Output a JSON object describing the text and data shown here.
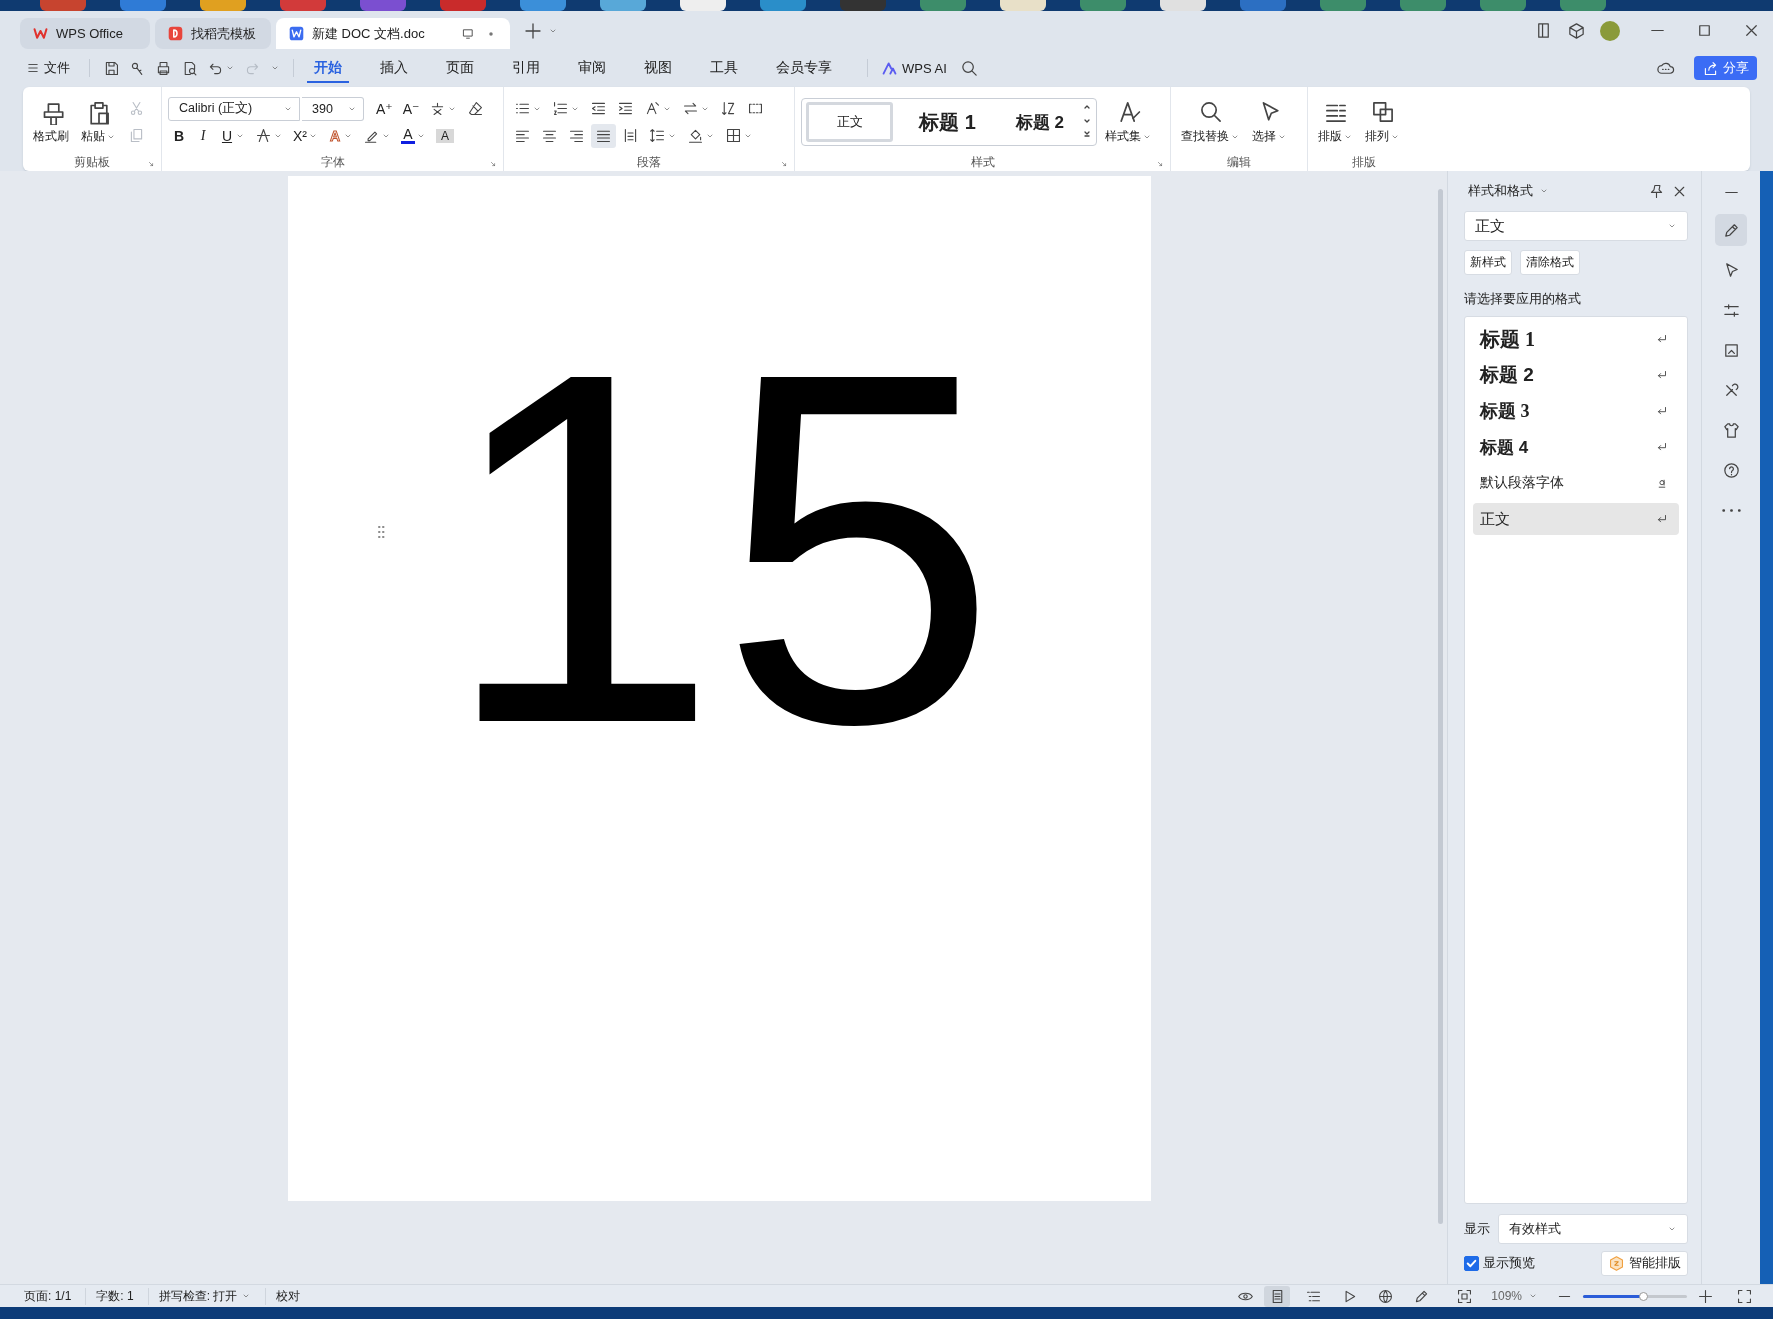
{
  "tabs": [
    {
      "label": "WPS Office",
      "kind": "home",
      "selected": false
    },
    {
      "label": "找稻壳模板",
      "kind": "template",
      "selected": false
    },
    {
      "label": "新建 DOC 文档.doc",
      "kind": "document",
      "selected": true
    }
  ],
  "menu": {
    "file": "文件",
    "tabs": [
      {
        "label": "开始",
        "selected": true
      },
      {
        "label": "插入",
        "selected": false
      },
      {
        "label": "页面",
        "selected": false
      },
      {
        "label": "引用",
        "selected": false
      },
      {
        "label": "审阅",
        "selected": false
      },
      {
        "label": "视图",
        "selected": false
      },
      {
        "label": "工具",
        "selected": false
      },
      {
        "label": "会员专享",
        "selected": false
      }
    ],
    "ai": "WPS AI",
    "share": "分享"
  },
  "ribbon": {
    "clipboard": {
      "title": "剪贴板",
      "buttons": [
        {
          "label": "格式刷",
          "kind": "painter"
        },
        {
          "label": "粘贴",
          "kind": "paste",
          "dropdown": true
        }
      ],
      "small": [
        {
          "kind": "cut",
          "disabled": true
        },
        {
          "kind": "copy",
          "disabled": true
        }
      ]
    },
    "font": {
      "title": "字体",
      "name": "Calibri (正文)",
      "size": "390",
      "top": [
        {
          "kind": "grow",
          "glyph": "A⁺"
        },
        {
          "kind": "shrink",
          "glyph": "A⁻"
        },
        {
          "kind": "phonetic",
          "dropdown": true
        },
        {
          "kind": "eraser"
        }
      ],
      "bottom": [
        {
          "kind": "bold",
          "glyph": "B"
        },
        {
          "kind": "italic",
          "glyph": "I"
        },
        {
          "kind": "underline",
          "glyph": "U",
          "dropdown": true
        },
        {
          "kind": "strike",
          "dropdown": true
        },
        {
          "kind": "superscript",
          "glyph": "X²",
          "dropdown": true
        },
        {
          "kind": "effect",
          "glyph": "A",
          "dropdown": true
        },
        {
          "kind": "highlight",
          "dropdown": true
        },
        {
          "kind": "color",
          "glyph": "A",
          "dropdown": true
        },
        {
          "kind": "shading",
          "glyph": "A"
        }
      ]
    },
    "paragraph": {
      "title": "段落",
      "top": [
        {
          "kind": "bullets",
          "dropdown": true
        },
        {
          "kind": "numbering",
          "dropdown": true
        },
        {
          "kind": "outdent"
        },
        {
          "kind": "indent"
        },
        {
          "kind": "direction",
          "dropdown": true
        },
        {
          "kind": "swap",
          "dropdown": true
        },
        {
          "kind": "sort"
        },
        {
          "kind": "marks"
        }
      ],
      "alignment": [
        {
          "kind": "align-left",
          "selected": false
        },
        {
          "kind": "align-center",
          "selected": false
        },
        {
          "kind": "align-right",
          "selected": false
        },
        {
          "kind": "justify",
          "selected": true
        },
        {
          "kind": "distribute",
          "selected": false
        }
      ],
      "bottom": [
        {
          "kind": "spacing",
          "dropdown": true
        },
        {
          "kind": "fill",
          "dropdown": true
        },
        {
          "kind": "border",
          "dropdown": true
        }
      ]
    },
    "styles": {
      "title": "样式",
      "gallery": [
        {
          "label": "正文",
          "kind": "normal",
          "selected": true
        },
        {
          "label": "标题 1",
          "kind": "heading1",
          "selected": false
        },
        {
          "label": "标题 2",
          "kind": "heading2",
          "selected": false
        }
      ],
      "style_set": {
        "label": "样式集",
        "kind": "style-set",
        "dropdown": true
      }
    },
    "editing": {
      "title": "编辑",
      "buttons": [
        {
          "label": "查找替换",
          "kind": "find",
          "dropdown": true
        },
        {
          "label": "选择",
          "kind": "select",
          "dropdown": true
        }
      ]
    },
    "arrange": {
      "title": "排版",
      "buttons": [
        {
          "label": "排版",
          "kind": "layout",
          "dropdown": true
        },
        {
          "label": "排列",
          "kind": "arrange",
          "dropdown": true
        }
      ]
    }
  },
  "document": {
    "text": "15"
  },
  "panel": {
    "title": "样式和格式",
    "current_style": "正文",
    "buttons": [
      "新样式",
      "清除格式"
    ],
    "prompt": "请选择要应用的格式",
    "styles": [
      {
        "label": "标题 1",
        "kind": "heading1",
        "selected": false
      },
      {
        "label": "标题 2",
        "kind": "heading2",
        "selected": false
      },
      {
        "label": "标题 3",
        "kind": "heading3",
        "selected": false
      },
      {
        "label": "标题 4",
        "kind": "heading4",
        "selected": false
      },
      {
        "label": "默认段落字体",
        "kind": "character",
        "selected": false
      },
      {
        "label": "正文",
        "kind": "paragraph",
        "selected": true
      }
    ],
    "show_label": "显示",
    "show_value": "有效样式",
    "preview": {
      "label": "显示预览",
      "checked": true
    },
    "smart_button": "智能排版"
  },
  "side_tools": [
    {
      "kind": "pen",
      "selected": true
    },
    {
      "kind": "cursor",
      "selected": false
    },
    {
      "kind": "sliders",
      "selected": false
    },
    {
      "kind": "image",
      "selected": false
    },
    {
      "kind": "tools",
      "selected": false
    },
    {
      "kind": "shirt",
      "selected": false
    },
    {
      "kind": "help",
      "selected": false
    },
    {
      "kind": "more",
      "selected": false
    }
  ],
  "status_bar": {
    "page": "页面: 1/1",
    "words": "字数: 1",
    "spell": "拼写检查: 打开",
    "proofread": "校对",
    "views": [
      {
        "kind": "page",
        "selected": true
      },
      {
        "kind": "outline",
        "selected": false
      },
      {
        "kind": "play",
        "selected": false
      },
      {
        "kind": "web",
        "selected": false
      },
      {
        "kind": "pen",
        "selected": false
      }
    ],
    "zoom": "109%",
    "zoom_slider": {
      "level": 0.58
    }
  }
}
